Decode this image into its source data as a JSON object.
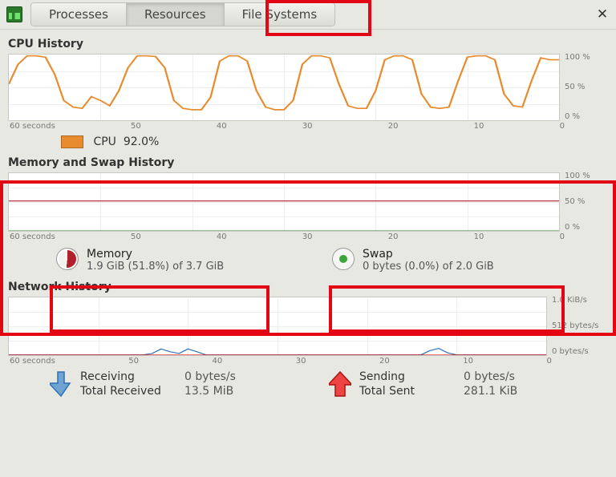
{
  "tabs": {
    "processes": "Processes",
    "resources": "Resources",
    "filesystems": "File Systems"
  },
  "sections": {
    "cpu_title": "CPU History",
    "mem_title": "Memory and Swap History",
    "net_title": "Network History"
  },
  "xaxis": {
    "t60": "60 seconds",
    "t50": "50",
    "t40": "40",
    "t30": "30",
    "t20": "20",
    "t10": "10",
    "t0": "0"
  },
  "yaxis_pct": {
    "y100": "100 %",
    "y50": "50 %",
    "y0": "0 %"
  },
  "yaxis_net": {
    "y1k": "1.0 KiB/s",
    "y512": "512 bytes/s",
    "y0": "0 bytes/s"
  },
  "cpu": {
    "color": "#e88b2e",
    "label": "CPU",
    "value": "92.0%"
  },
  "memory": {
    "mem_label": "Memory",
    "mem_value": "1.9 GiB (51.8%) of 3.7 GiB",
    "swap_label": "Swap",
    "swap_value": "0 bytes (0.0%) of 2.0 GiB",
    "mem_pct": 51.8,
    "swap_pct": 0.0
  },
  "network": {
    "recv_label": "Receiving",
    "recv_rate": "0 bytes/s",
    "recv_total_label": "Total Received",
    "recv_total": "13.5 MiB",
    "send_label": "Sending",
    "send_rate": "0 bytes/s",
    "send_total_label": "Total Sent",
    "send_total": "281.1 KiB",
    "recv_color": "#2f6fb3",
    "send_color": "#d11"
  },
  "chart_data": [
    {
      "type": "line",
      "title": "CPU History",
      "xlabel": "seconds",
      "ylabel": "%",
      "ylim": [
        0,
        100
      ],
      "xlim": [
        60,
        0
      ],
      "series": [
        {
          "name": "CPU",
          "color": "#e88b2e",
          "x": [
            60,
            59,
            58,
            57,
            56,
            55,
            54,
            53,
            52,
            51,
            50,
            49,
            48,
            47,
            46,
            45,
            44,
            43,
            42,
            41,
            40,
            39,
            38,
            37,
            36,
            35,
            34,
            33,
            32,
            31,
            30,
            29,
            28,
            27,
            26,
            25,
            24,
            23,
            22,
            21,
            20,
            19,
            18,
            17,
            16,
            15,
            14,
            13,
            12,
            11,
            10,
            9,
            8,
            7,
            6,
            5,
            4,
            3,
            2,
            1,
            0
          ],
          "y": [
            55,
            85,
            98,
            98,
            96,
            70,
            30,
            20,
            18,
            36,
            30,
            22,
            45,
            80,
            98,
            98,
            97,
            80,
            30,
            18,
            16,
            16,
            35,
            90,
            98,
            98,
            90,
            45,
            20,
            16,
            16,
            30,
            85,
            98,
            98,
            95,
            55,
            22,
            18,
            18,
            45,
            92,
            98,
            98,
            92,
            40,
            20,
            18,
            20,
            60,
            96,
            98,
            98,
            92,
            40,
            22,
            20,
            60,
            95,
            92,
            92
          ]
        }
      ]
    },
    {
      "type": "line",
      "title": "Memory and Swap History",
      "xlabel": "seconds",
      "ylabel": "%",
      "ylim": [
        0,
        100
      ],
      "xlim": [
        60,
        0
      ],
      "series": [
        {
          "name": "Memory",
          "color": "#b1202a",
          "x": [
            60,
            0
          ],
          "y": [
            51.8,
            51.8
          ]
        },
        {
          "name": "Swap",
          "color": "#2e8b2e",
          "x": [
            60,
            0
          ],
          "y": [
            0,
            0
          ]
        }
      ]
    },
    {
      "type": "line",
      "title": "Network History",
      "xlabel": "seconds",
      "ylabel": "bytes/s",
      "ylim": [
        0,
        1024
      ],
      "xlim": [
        60,
        0
      ],
      "series": [
        {
          "name": "Receiving",
          "color": "#2f6fb3",
          "x": [
            60,
            50,
            45,
            44,
            43,
            42,
            41,
            40,
            39,
            38,
            30,
            14,
            13,
            12,
            11,
            10,
            0
          ],
          "y": [
            5,
            5,
            5,
            30,
            110,
            60,
            30,
            110,
            60,
            5,
            5,
            5,
            80,
            120,
            40,
            5,
            5
          ]
        },
        {
          "name": "Sending",
          "color": "#d11",
          "x": [
            60,
            0
          ],
          "y": [
            2,
            2
          ]
        }
      ]
    }
  ]
}
